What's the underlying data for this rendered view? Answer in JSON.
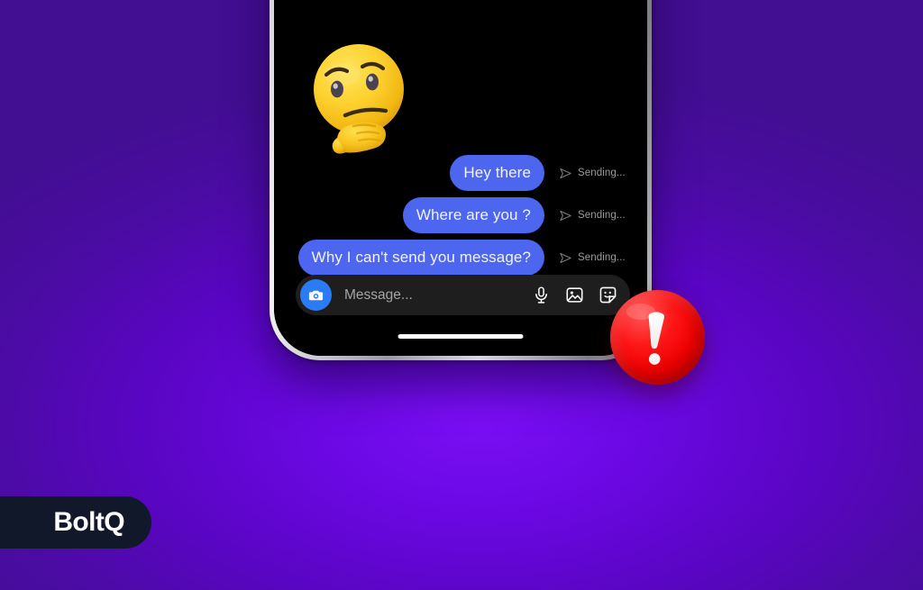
{
  "background": {
    "accent_purple": "#6a08e2",
    "edge_purple": "#420e92"
  },
  "phone": {
    "device_name": "smartphone-mockup",
    "screen_bg": "#000000",
    "home_indicator": "home-indicator"
  },
  "emoji": {
    "name": "thinking-face-emoji",
    "label": "Thinking Face"
  },
  "conversation": {
    "bubble_color": "#4c66f0",
    "status_color": "#9b9b9b",
    "messages": [
      {
        "text": "Hey there",
        "status": "Sending...",
        "status_icon": "send-arrow-icon"
      },
      {
        "text": "Where are you ?",
        "status": "Sending...",
        "status_icon": "send-arrow-icon"
      },
      {
        "text": "Why I can't send you message?",
        "status": "Sending...",
        "status_icon": "send-arrow-icon"
      }
    ]
  },
  "input_bar": {
    "camera_button": "camera-icon",
    "placeholder": "Message...",
    "value": "",
    "actions": [
      {
        "name": "microphone-icon",
        "label": "Voice message"
      },
      {
        "name": "image-icon",
        "label": "Photo"
      },
      {
        "name": "sticker-icon",
        "label": "Sticker"
      }
    ]
  },
  "error_badge": {
    "name": "error-exclamation-badge",
    "symbol": "!",
    "color": "#ef0000"
  },
  "branding": {
    "logo_text": "BoltQ",
    "pill_color": "#11182a"
  }
}
